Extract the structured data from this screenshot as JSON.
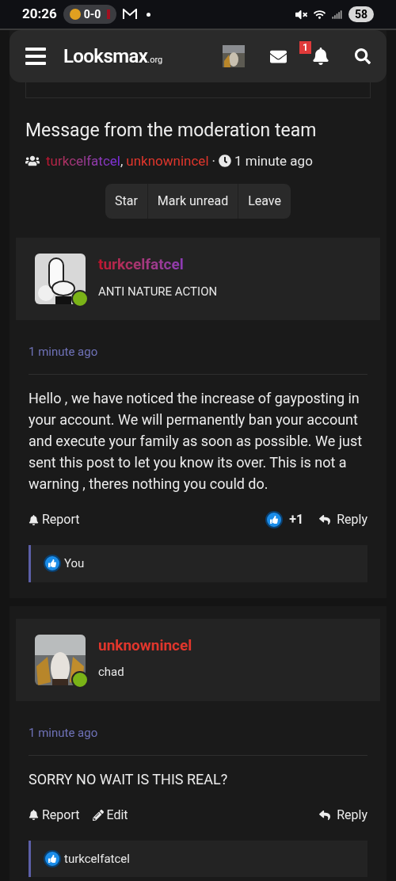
{
  "status_bar": {
    "time": "20:26",
    "score": "0-0",
    "battery": "58"
  },
  "header": {
    "logo": "Looksmax",
    "logo_suffix": ".org",
    "notification_count": "1"
  },
  "conversation": {
    "title": "Message from the moderation team",
    "participants": [
      {
        "name": "turkcelfatcel",
        "kind": "gradient"
      },
      {
        "name": "unknownincel",
        "kind": "plain"
      }
    ],
    "separator": ",",
    "dot": "·",
    "time": "1 minute ago",
    "buttons": [
      "Star",
      "Mark unread",
      "Leave"
    ]
  },
  "posts": [
    {
      "author": "turkcelfatcel",
      "kind": "gradient",
      "user_title": "ANTI NATURE ACTION",
      "online": true,
      "time": "1 minute ago",
      "body": "Hello , we have noticed the increase of gayposting in your account. We will permanently ban your account and execute your family as soon as possible. We just sent this post to let you know its over. This is not a warning , theres nothing you could do.",
      "actions": [
        {
          "kind": "report",
          "label": "Report"
        }
      ],
      "reaction_count": "+1",
      "reply": "Reply",
      "reactions": "You"
    },
    {
      "author": "unknownincel",
      "kind": "plain",
      "user_title": "chad",
      "online": true,
      "time": "1 minute ago",
      "body": "SORRY NO WAIT IS THIS REAL?",
      "actions": [
        {
          "kind": "report",
          "label": "Report"
        },
        {
          "kind": "edit",
          "label": "Edit"
        }
      ],
      "reply": "Reply",
      "reactions": "turkcelfatcel"
    }
  ]
}
